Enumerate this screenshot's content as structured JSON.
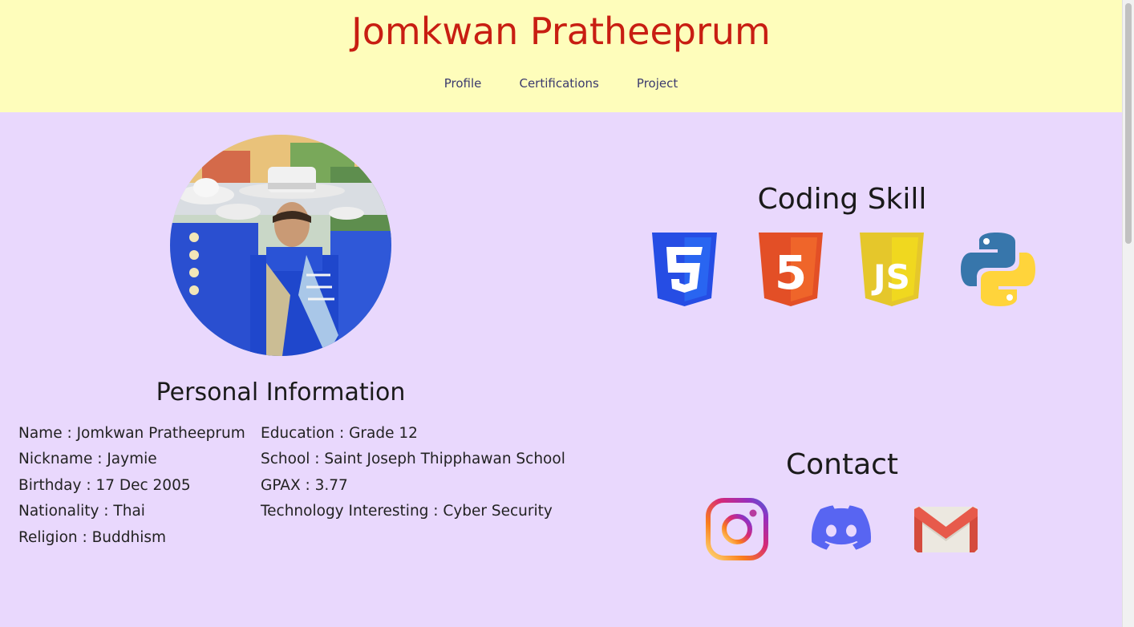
{
  "header": {
    "title": "Jomkwan Pratheeprum",
    "nav": [
      "Profile",
      "Certifications",
      "Project"
    ]
  },
  "personal": {
    "heading": "Personal Information",
    "left": [
      "Name : Jomkwan Pratheeprum",
      "Nickname : Jaymie",
      "Birthday : 17 Dec 2005",
      "Nationality : Thai",
      "Religion : Buddhism"
    ],
    "right": [
      "Education : Grade 12",
      "School : Saint Joseph Thipphawan School",
      "GPAX : 3.77",
      "Technology Interesting : Cyber Security"
    ]
  },
  "skills": {
    "heading": "Coding Skill",
    "icons": [
      "css3-icon",
      "html5-icon",
      "javascript-icon",
      "python-icon"
    ],
    "html_badge": "5",
    "js_badge": "JS"
  },
  "contact": {
    "heading": "Contact",
    "icons": [
      "instagram-icon",
      "discord-icon",
      "gmail-icon"
    ]
  },
  "colors": {
    "header_bg": "#fefdbb",
    "page_bg": "#e9d8fd",
    "title": "#c81e12",
    "nav_link": "#3b3a6e"
  }
}
